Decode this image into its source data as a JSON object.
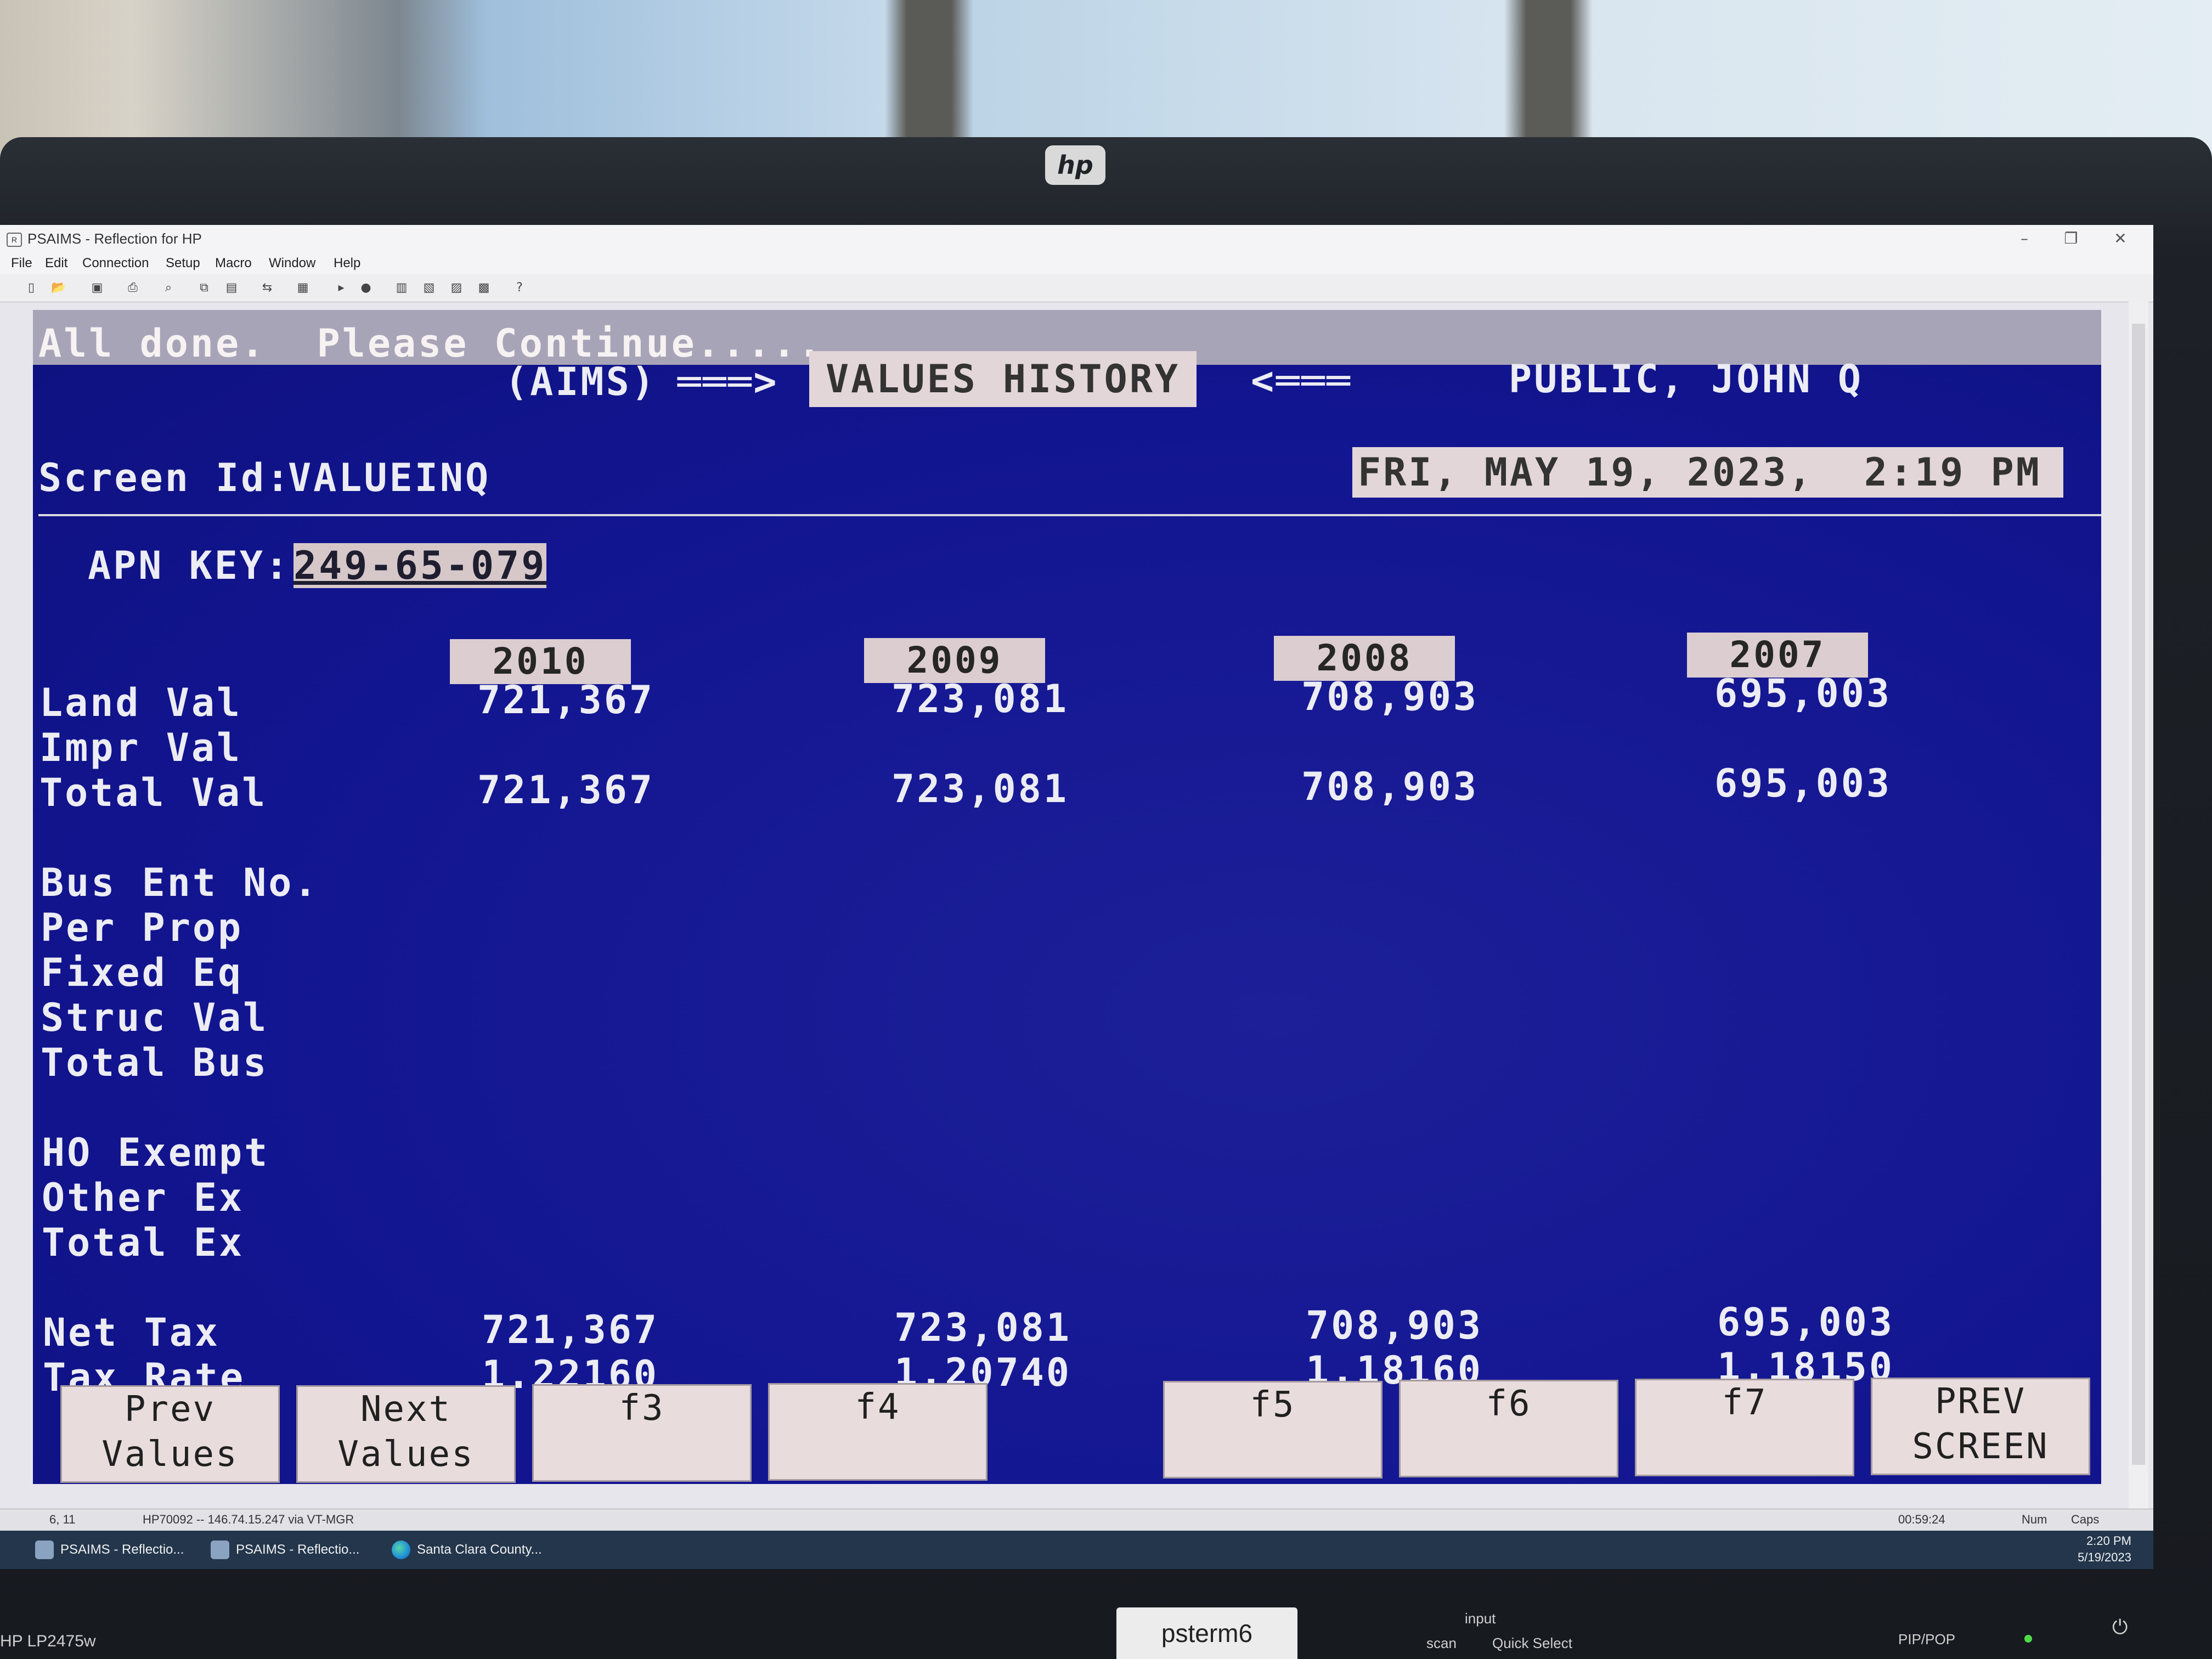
{
  "window": {
    "title": "PSAIMS - Reflection for HP",
    "controls": [
      "–",
      "❐",
      "✕"
    ]
  },
  "menu": [
    "File",
    "Edit",
    "Connection",
    "Setup",
    "Macro",
    "Window",
    "Help"
  ],
  "terminal": {
    "message": "All done.  Please Continue.....",
    "system_label": "(AIMS)",
    "arrow_right": "═══>",
    "screen_title": "VALUES HISTORY",
    "arrow_left": "<═══",
    "owner_name": "PUBLIC, JOHN Q",
    "screen_id_label": "Screen Id:",
    "screen_id_value": "VALUEINQ",
    "datetime": "FRI, MAY 19, 2023,  2:19 PM",
    "apn_label": "APN KEY:",
    "apn_value": "249-65-079",
    "years": [
      "2010",
      "2009",
      "2008",
      "2007"
    ],
    "rows": {
      "land_val": {
        "label": "Land Val",
        "values": [
          "721,367",
          "723,081",
          "708,903",
          "695,003"
        ]
      },
      "impr_val": {
        "label": "Impr Val"
      },
      "total_val": {
        "label": "Total Val",
        "values": [
          "721,367",
          "723,081",
          "708,903",
          "695,003"
        ]
      },
      "bus_ent_no": {
        "label": "Bus Ent No."
      },
      "per_prop": {
        "label": "Per Prop"
      },
      "fixed_eq": {
        "label": "Fixed Eq"
      },
      "struc_val": {
        "label": "Struc Val"
      },
      "total_bus": {
        "label": "Total Bus"
      },
      "ho_exempt": {
        "label": "HO Exempt"
      },
      "other_ex": {
        "label": "Other Ex"
      },
      "total_ex": {
        "label": "Total Ex"
      },
      "net_tax": {
        "label": "Net Tax",
        "values": [
          "721,367",
          "723,081",
          "708,903",
          "695,003"
        ]
      },
      "tax_rate": {
        "label": "Tax Rate",
        "values": [
          "1.22160",
          "1.20740",
          "1.18160",
          "1.18150"
        ]
      }
    },
    "function_keys": [
      "Prev\nValues",
      "Next\nValues",
      "f3",
      "f4",
      "f5",
      "f6",
      "f7",
      "PREV\nSCREEN"
    ]
  },
  "statusbar": {
    "cursor": "6, 11",
    "connection": "HP70092 -- 146.74.15.247 via VT-MGR",
    "timer": "00:59:24",
    "num": "Num",
    "caps": "Caps"
  },
  "taskbar": {
    "tasks": [
      "PSAIMS - Reflectio...",
      "PSAIMS - Reflectio...",
      "Santa Clara County..."
    ],
    "time": "2:20 PM",
    "date": "5/19/2023"
  },
  "monitor": {
    "brand": "hp",
    "model": "HP LP2475w",
    "osd_label": "psterm6",
    "buttons": {
      "input": "input",
      "scan": "scan",
      "quick_select": "Quick Select",
      "pip": "PIP/POP"
    }
  },
  "colors": {
    "terminal_bg": "#16199b",
    "highlight_bg": "#dccdd0",
    "text": "#ececf4"
  }
}
